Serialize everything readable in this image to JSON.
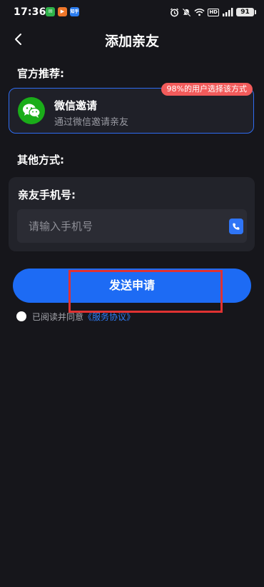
{
  "status_bar": {
    "time": "17:36",
    "notif_apps": [
      "app-green",
      "app-orange",
      "知乎"
    ],
    "hd": "HD",
    "battery": "91"
  },
  "header": {
    "title": "添加亲友"
  },
  "recommend": {
    "section_label": "官方推荐:",
    "badge": "98%的用户选择该方式",
    "title": "微信邀请",
    "subtitle": "通过微信邀请亲友"
  },
  "other": {
    "section_label": "其他方式:",
    "phone_label": "亲友手机号:",
    "phone_placeholder": "请输入手机号",
    "phone_value": ""
  },
  "actions": {
    "send_label": "发送申请"
  },
  "agreement": {
    "prefix": "已阅读并同意",
    "link": "《服务协议》"
  },
  "colors": {
    "background": "#16161b",
    "accent_blue": "#1d6bf4",
    "badge_red": "#f25b5b",
    "wechat_green": "#1aad19",
    "highlight_red": "#e03232"
  }
}
